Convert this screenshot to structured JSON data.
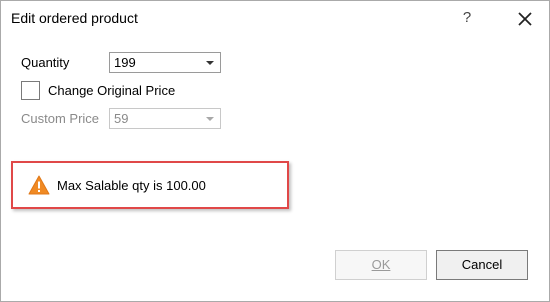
{
  "dialog": {
    "title": "Edit ordered product",
    "help_label": "?",
    "close_icon": "close-icon"
  },
  "form": {
    "quantity_label": "Quantity",
    "quantity_value": "199",
    "change_price_label": "Change Original Price",
    "change_price_checked": false,
    "custom_price_label": "Custom Price",
    "custom_price_value": "59"
  },
  "alert": {
    "icon": "warning-icon",
    "message": "Max Salable qty is 100.00",
    "border_color": "#e04848",
    "icon_color": "#f08a24"
  },
  "buttons": {
    "ok_label": "OK",
    "cancel_label": "Cancel"
  }
}
